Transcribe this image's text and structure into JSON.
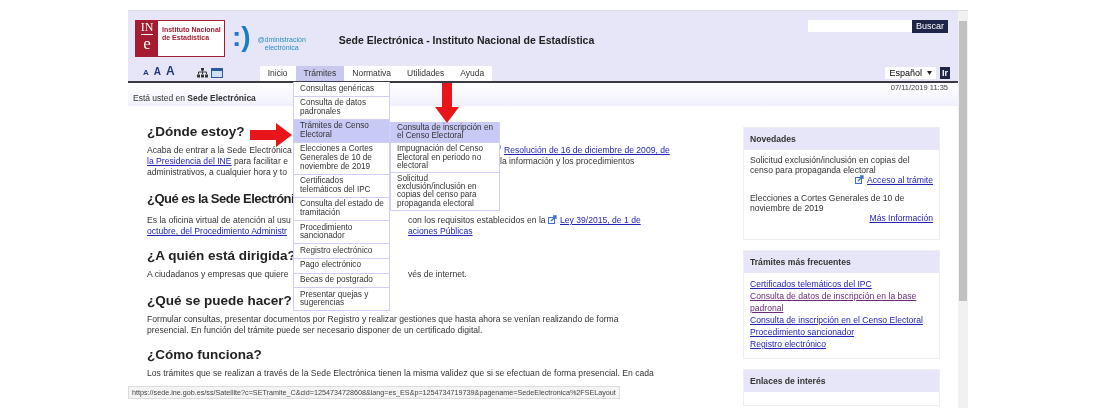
{
  "header": {
    "logo_mark": [
      "IN",
      "e"
    ],
    "logo_text": "Instituto Nacional de Estadística",
    "admin_logo_mark": ":)",
    "admin_logo_text": "@dministración electrónica",
    "site_title": "Sede Electrónica - Instituto Nacional de Estadística",
    "search_button": "Buscar"
  },
  "font_size_buttons": [
    "A",
    "A",
    "A"
  ],
  "tabs": [
    {
      "label": "Inicio",
      "selected": false
    },
    {
      "label": "Trámites",
      "selected": true
    },
    {
      "label": "Normativa",
      "selected": false
    },
    {
      "label": "Utilidades",
      "selected": false
    },
    {
      "label": "Ayuda",
      "selected": false
    }
  ],
  "language": {
    "value": "Español",
    "go_button": "Ir"
  },
  "breadcrumb": "Está usted en **Sede Electrónica**",
  "datetime": "07/11/2019 11:35",
  "main": [
    {
      "heading": "¿Dónde estoy?",
      "lines": [
        {
          "left": [
            {
              "kind": "text",
              "text": "Acaba de entrar a la Sede Electrónica"
            }
          ],
          "right": [
            {
              "kind": "ext_link",
              "text": "Resolución de 16 de diciembre de 2009, de"
            }
          ]
        },
        {
          "left": [
            {
              "kind": "link",
              "text": "la Presidencia del INE"
            },
            {
              "kind": "text",
              "text": " para facilitar e"
            }
          ],
          "right": [
            {
              "kind": "text",
              "text": "la información y los procedimientos"
            }
          ]
        },
        {
          "left": [
            {
              "kind": "text",
              "text": "administrativos, a cualquier hora y to"
            }
          ]
        }
      ]
    },
    {
      "heading": "¿Qué es la Sede Electróni",
      "lines": [
        {
          "left": [
            {
              "kind": "text",
              "text": "Es la oficina virtual de atención al usu"
            }
          ],
          "right": [
            {
              "kind": "text",
              "text": "con los requisitos establecidos en la "
            },
            {
              "kind": "ext_link",
              "text": "Ley 39/2015, de 1 de"
            }
          ]
        },
        {
          "left": [
            {
              "kind": "link",
              "text": "octubre, del Procedimiento Administr"
            }
          ],
          "right": [
            {
              "kind": "link",
              "text": "aciones Públicas"
            }
          ]
        }
      ]
    },
    {
      "heading": "¿A quién está dirigida?",
      "lines": [
        {
          "left": [
            {
              "kind": "text",
              "text": "A ciudadanos y empresas que quiere"
            }
          ],
          "right": [
            {
              "kind": "text",
              "text": "vés de internet."
            }
          ]
        }
      ]
    },
    {
      "heading": "¿Qué se puede hacer?",
      "lines": [
        {
          "left": [
            {
              "kind": "text",
              "text": "Formular consultas, presentar documentos por Registro y realizar gestiones que hasta ahora se venían realizando de forma"
            }
          ]
        },
        {
          "left": [
            {
              "kind": "text",
              "text": "presencial. En función del trámite puede ser necesario disponer de un certificado digital."
            }
          ]
        }
      ]
    },
    {
      "heading": "¿Cómo funciona?",
      "lines": [
        {
          "left": [
            {
              "kind": "text",
              "text": "Los trámites que se realizan a través de la Sede Electrónica tienen la misma validez que si se efectuan de forma presencial. En cada"
            }
          ]
        }
      ]
    }
  ],
  "sidebar": [
    {
      "title": "Novedades",
      "kind": "news",
      "items": [
        {
          "text": "Solicitud exclusión/inclusión en copias del censo para propaganda electoral",
          "link": "Acceso al trámite",
          "external": true
        },
        {
          "text": "Elecciones a Cortes Generales de 10 de noviembre de 2019",
          "link": "Más Información",
          "external": false
        }
      ]
    },
    {
      "title": "Trámites más frecuentes",
      "kind": "links",
      "links": [
        {
          "text": "Certificados telemáticos del IPC",
          "visited": false
        },
        {
          "text": "Consulta de datos de inscripción en la base padronal",
          "visited": true
        },
        {
          "text": "Consulta de inscripción en el Censo Electoral",
          "visited": false
        },
        {
          "text": "Procedimiento sancionador",
          "visited": false
        },
        {
          "text": "Registro electrónico",
          "visited": false
        }
      ]
    },
    {
      "title": "Enlaces de interés",
      "kind": "links"
    }
  ],
  "menu": [
    {
      "label": "Consultas genéricas",
      "selected": false
    },
    {
      "label": "Consulta de datos padronales",
      "selected": false
    },
    {
      "label": "Trámites de Censo Electoral",
      "selected": true
    },
    {
      "label": "Elecciones a Cortes Generales de 10 de noviembre de 2019",
      "selected": false
    },
    {
      "label": "Certificados telemáticos del IPC",
      "selected": false
    },
    {
      "label": "Consulta del estado de tramitación",
      "selected": false
    },
    {
      "label": "Procedimiento sancionador",
      "selected": false
    },
    {
      "label": "Registro electrónico",
      "selected": false
    },
    {
      "label": "Pago electrónico",
      "selected": false
    },
    {
      "label": "Becas de postgrado",
      "selected": false
    },
    {
      "label": "Presentar quejas y sugerencias",
      "selected": false
    }
  ],
  "submenu": [
    {
      "label": "Consulta de inscripción en el Censo Electoral",
      "selected": true
    },
    {
      "label": "Impugnación del Censo Electoral en periodo no electoral",
      "selected": false
    },
    {
      "label": "Solicitud exclusión/inclusión en copias del censo para propaganda electoral",
      "selected": false
    }
  ],
  "status_url": "https://sede.ine.gob.es/ss/Satellite?c=SETramite_C&cid=1254734728608&lang=es_ES&p=1254734719739&pagename=SedeElectronica%2FSELayout"
}
